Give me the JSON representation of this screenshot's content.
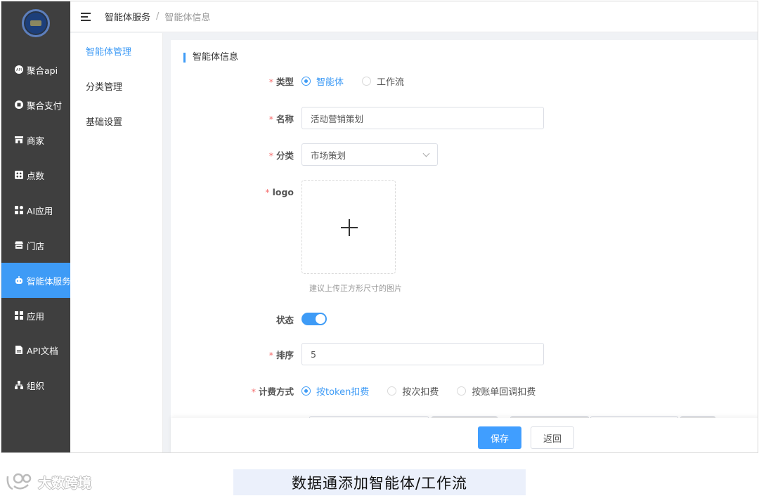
{
  "nav": {
    "items": [
      {
        "label": "聚合api",
        "icon": "api-circle-icon"
      },
      {
        "label": "聚合支付",
        "icon": "payment-circle-icon"
      },
      {
        "label": "商家",
        "icon": "store-icon"
      },
      {
        "label": "点数",
        "icon": "points-icon"
      },
      {
        "label": "AI应用",
        "icon": "apps-grid-icon"
      },
      {
        "label": "门店",
        "icon": "shop-icon"
      },
      {
        "label": "智能体服务",
        "icon": "robot-icon"
      },
      {
        "label": "应用",
        "icon": "grid-icon"
      },
      {
        "label": "API文档",
        "icon": "document-icon"
      },
      {
        "label": "组织",
        "icon": "org-tree-icon"
      }
    ],
    "active_index": 6
  },
  "header": {
    "breadcrumb_parent": "智能体服务",
    "breadcrumb_separator": "/",
    "breadcrumb_current": "智能体信息"
  },
  "submenu": {
    "items": [
      "智能体管理",
      "分类管理",
      "基础设置"
    ],
    "active_index": 0
  },
  "form": {
    "section_title": "智能体信息",
    "type": {
      "label": "类型",
      "options": [
        "智能体",
        "工作流"
      ],
      "selected": 0
    },
    "name": {
      "label": "名称",
      "value": "活动营销策划"
    },
    "category": {
      "label": "分类",
      "value": "市场策划"
    },
    "logo": {
      "label": "logo",
      "hint": "建议上传正方形尺寸的图片"
    },
    "status": {
      "label": "状态",
      "enabled": true
    },
    "sort": {
      "label": "排序",
      "value": "5"
    },
    "billing": {
      "label": "计费方式",
      "options": [
        "按token扣费",
        "按次扣费",
        "按账单回调扣费"
      ],
      "selected": 0
    },
    "required_mark": "*"
  },
  "footer": {
    "save_label": "保存",
    "back_label": "返回"
  },
  "watermark": {
    "text": "大数跨境"
  },
  "caption": {
    "text": "数据通添加智能体/工作流"
  },
  "colors": {
    "accent": "#3e9bf6",
    "nav_bg": "#3f3f3f",
    "required": "#f56c6c"
  }
}
